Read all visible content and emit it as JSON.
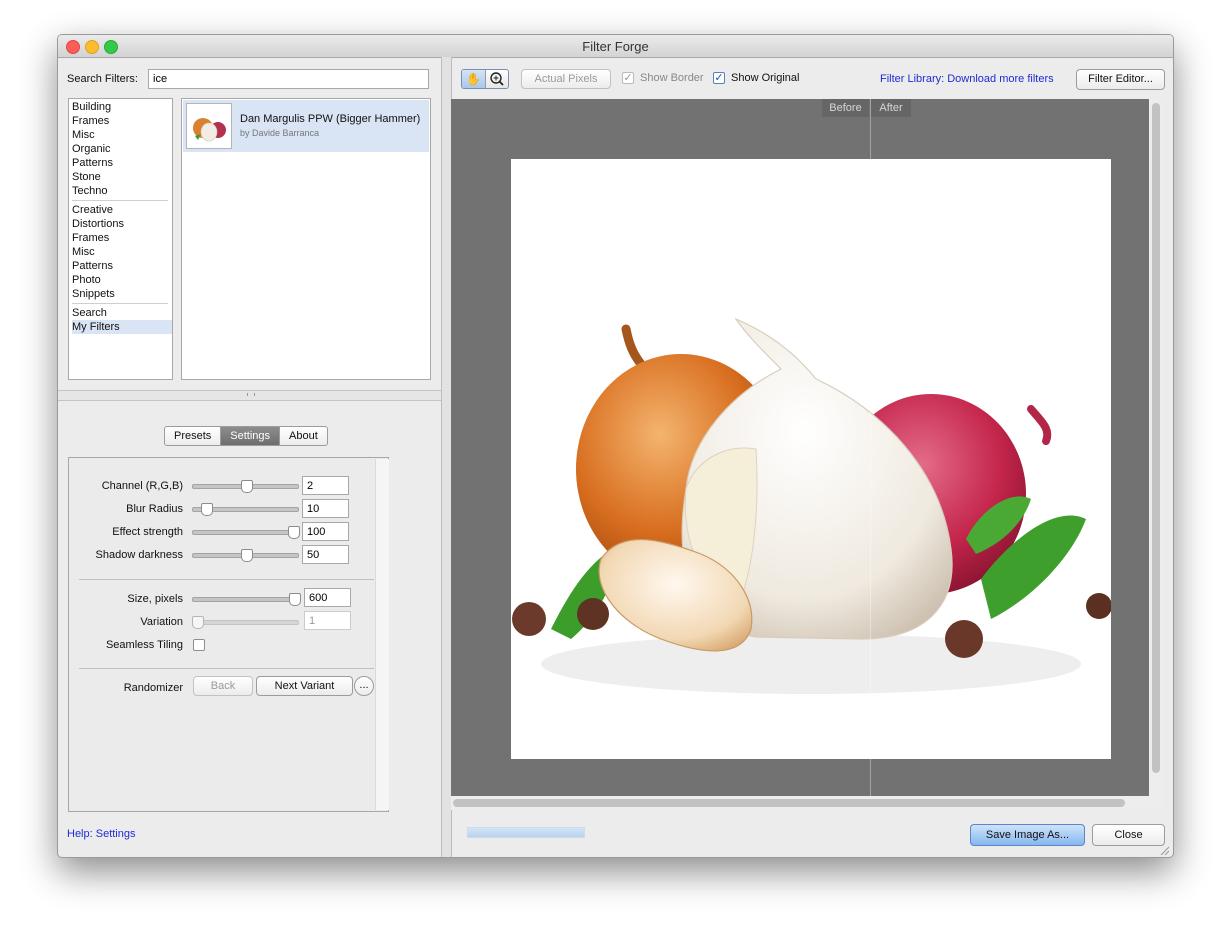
{
  "window": {
    "title": "Filter Forge"
  },
  "search": {
    "label": "Search Filters:",
    "value": "ice"
  },
  "categories": {
    "group1": [
      "Building",
      "Frames",
      "Misc",
      "Organic",
      "Patterns",
      "Stone",
      "Techno"
    ],
    "group2": [
      "Creative",
      "Distortions",
      "Frames",
      "Misc",
      "Patterns",
      "Photo",
      "Snippets"
    ],
    "group3": [
      "Search",
      "My Filters"
    ],
    "selected": "My Filters"
  },
  "filter_result": {
    "name": "Dan Margulis PPW (Bigger Hammer)",
    "author": "by Davide Barranca"
  },
  "tabs": {
    "presets": "Presets",
    "settings": "Settings",
    "about": "About",
    "active": "Settings"
  },
  "settings": {
    "sliders": [
      {
        "label": "Channel (R,G,B)",
        "value": "2",
        "position": 0.5
      },
      {
        "label": "Blur Radius",
        "value": "10",
        "position": 0.12
      },
      {
        "label": "Effect strength",
        "value": "100",
        "position": 0.95
      },
      {
        "label": "Shadow darkness",
        "value": "50",
        "position": 0.5
      }
    ],
    "size_label": "Size, pixels",
    "size_value": "600",
    "size_position": 0.96,
    "variation_label": "Variation",
    "variation_value": "1",
    "variation_position": 0.04,
    "seamless_label": "Seamless Tiling",
    "seamless_checked": false,
    "randomizer_label": "Randomizer",
    "back_label": "Back",
    "next_variant_label": "Next Variant",
    "more_label": "..."
  },
  "help_link": "Help: Settings",
  "toolbar": {
    "actual_pixels": "Actual Pixels",
    "show_border": "Show Border",
    "show_border_checked": true,
    "show_original": "Show Original",
    "show_original_checked": true,
    "library_link": "Filter Library: Download more filters",
    "filter_editor": "Filter Editor..."
  },
  "preview": {
    "before_label": "Before",
    "after_label": "After"
  },
  "bottom": {
    "save_label": "Save Image As...",
    "close_label": "Close"
  },
  "colors": {
    "link": "#1f2bd6",
    "preview_bg": "#727272",
    "selection": "#d9e4f5",
    "primary_button": "#86b7ef"
  }
}
